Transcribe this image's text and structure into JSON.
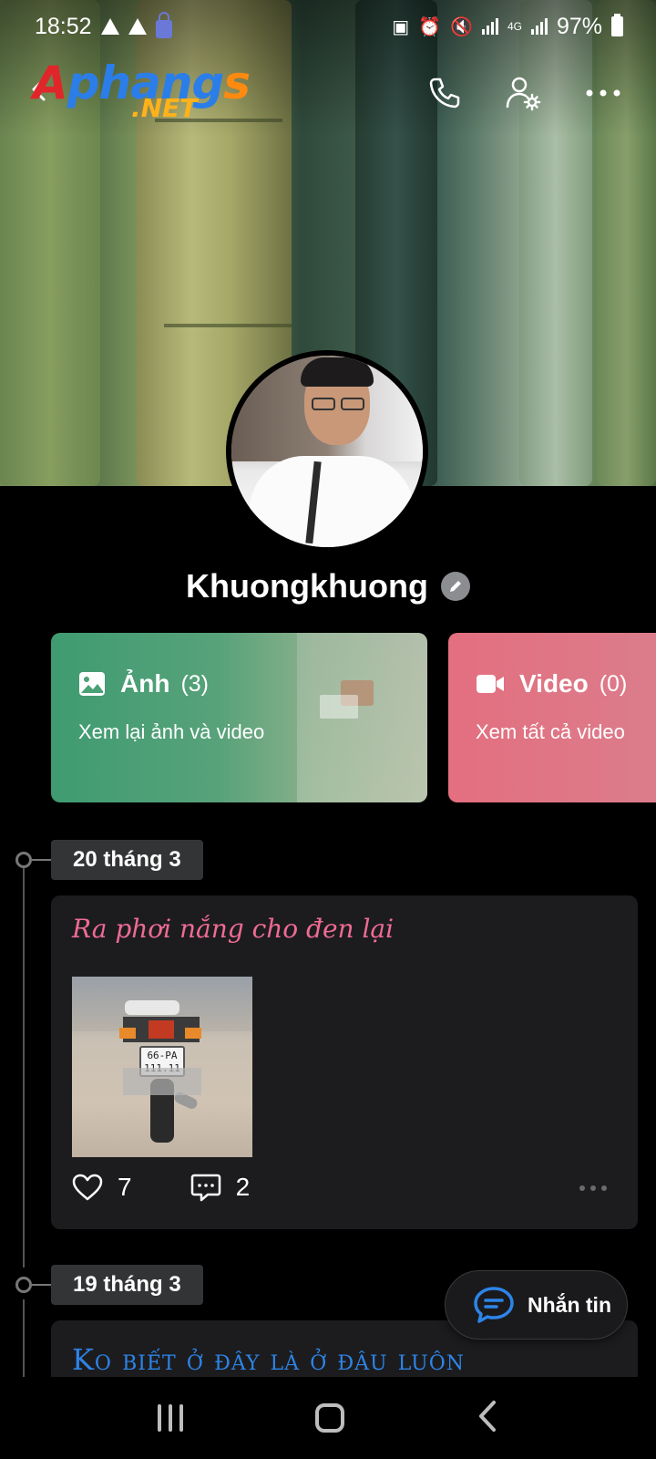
{
  "status_bar": {
    "time": "18:52",
    "network": "4G",
    "battery": "97%"
  },
  "toolbar": {
    "logo_main": "Aphangs",
    "logo_sub": ".NET",
    "icons": [
      "back-arrow-icon",
      "phone-icon",
      "user-settings-icon",
      "more-horizontal-icon"
    ]
  },
  "profile": {
    "name": "Khuongkhuong"
  },
  "media_cards": {
    "photos": {
      "title": "Ảnh",
      "count": "(3)",
      "subtitle": "Xem lại ảnh và video"
    },
    "videos": {
      "title": "Video",
      "count": "(0)",
      "subtitle": "Xem tất cả video"
    }
  },
  "timeline": [
    {
      "date": "20 tháng 3",
      "post": {
        "text": "Ra phơi nắng cho đen lại",
        "plate_line1": "66-PA",
        "plate_line2": "111.11",
        "likes": "7",
        "comments": "2"
      }
    },
    {
      "date": "19 tháng 3",
      "post": {
        "text": "Ko biết ở đây là ở đâu luôn"
      }
    }
  ],
  "fab": {
    "label": "Nhắn tin"
  },
  "colors": {
    "photo_card": "#3f9b71",
    "video_card": "#e36f7f",
    "post_pink": "#f06b94",
    "post_blue": "#2d84e8",
    "fab_icon": "#2d84e8"
  }
}
